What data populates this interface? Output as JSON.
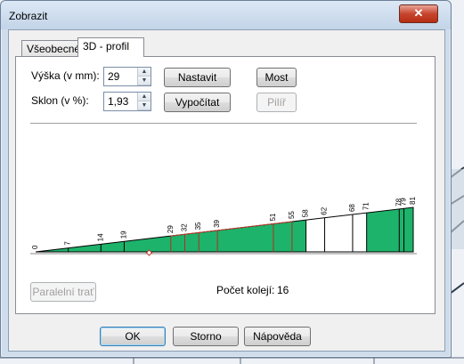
{
  "window": {
    "title": "Zobrazit",
    "close_label": "✕"
  },
  "tabs": [
    {
      "label": "Všeobecné",
      "active": false
    },
    {
      "label": "3D - profil",
      "active": true
    }
  ],
  "fields": {
    "height_label": "Výška (v mm):",
    "height_value": "29",
    "slope_label": "Sklon (v %):",
    "slope_value": "1,93"
  },
  "buttons": {
    "set": "Nastavit",
    "compute": "Vypočítat",
    "bridge": "Most",
    "pillar": "Pilíř",
    "parallel": "Paralelní trať",
    "ok": "OK",
    "cancel": "Storno",
    "help": "Nápověda"
  },
  "track_count": {
    "label": "Počet kolejí:",
    "value": "16"
  },
  "profile": {
    "fill_color": "#1db36b",
    "line_color": "#c0392b",
    "markers": [
      "0",
      "7",
      "14",
      "19",
      "29",
      "32",
      "35",
      "39",
      "51",
      "55",
      "58",
      "62",
      "68",
      "71",
      "78",
      "79",
      "81"
    ],
    "fill_segments": [
      {
        "from": "0",
        "to": "58"
      },
      {
        "from": "71",
        "to": "81"
      }
    ]
  }
}
